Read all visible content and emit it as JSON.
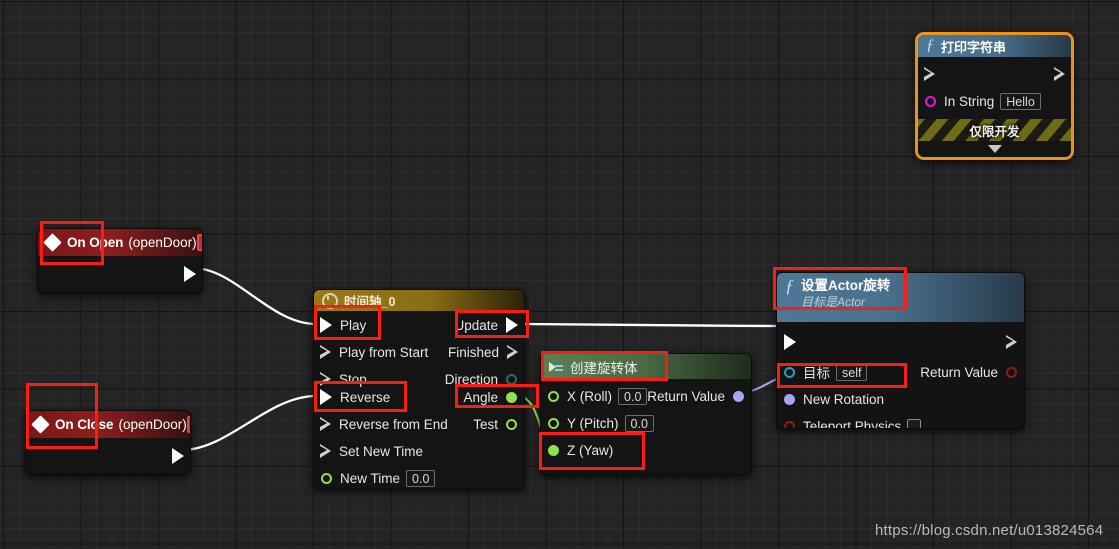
{
  "graph": {
    "watermark": "https://blog.csdn.net/u013824564",
    "accent_colors": {
      "annotation": "#fa1d16",
      "selected_node": "#e8941a",
      "exec_wire": "#ffffff",
      "float_wire": "#8fe24a",
      "rotator_wire": "#a3a8ee",
      "event_header": "#8d1e1e",
      "timeline_header": "#8a6d14",
      "function_header": "#49708d",
      "pure_header": "#4a6b44"
    }
  },
  "nodes": {
    "on_open": {
      "title": "On Open",
      "subtitle": "(openDoor)",
      "icon": "event-diamond-icon",
      "delegate_pin": "delegate-output-pin"
    },
    "on_close": {
      "title": "On Close",
      "subtitle": "(openDoor)",
      "icon": "event-diamond-icon",
      "delegate_pin": "delegate-output-pin"
    },
    "timeline": {
      "title": "时间轴_0",
      "icon": "clock-icon",
      "inputs": [
        {
          "label": "Play",
          "pin": "exec",
          "connected": true
        },
        {
          "label": "Play from Start",
          "pin": "exec",
          "connected": false
        },
        {
          "label": "Stop",
          "pin": "exec",
          "connected": false
        },
        {
          "label": "Reverse",
          "pin": "exec",
          "connected": true
        },
        {
          "label": "Reverse from End",
          "pin": "exec",
          "connected": false
        },
        {
          "label": "Set New Time",
          "pin": "exec",
          "connected": false
        },
        {
          "label": "New Time",
          "pin": "float",
          "connected": false,
          "value": "0.0"
        }
      ],
      "outputs": [
        {
          "label": "Update",
          "pin": "exec",
          "connected": true
        },
        {
          "label": "Finished",
          "pin": "exec",
          "connected": false
        },
        {
          "label": "Direction",
          "pin": "byte",
          "connected": false
        },
        {
          "label": "Angle",
          "pin": "float",
          "connected": true
        },
        {
          "label": "Test",
          "pin": "float",
          "connected": false
        }
      ]
    },
    "make_rotator": {
      "title": "创建旋转体",
      "icon": "pure-function-icon",
      "inputs": [
        {
          "label": "X (Roll)",
          "pin": "float",
          "connected": false,
          "value": "0.0"
        },
        {
          "label": "Y (Pitch)",
          "pin": "float",
          "connected": false,
          "value": "0.0"
        },
        {
          "label": "Z (Yaw)",
          "pin": "float",
          "connected": true
        }
      ],
      "outputs": [
        {
          "label": "Return Value",
          "pin": "rotator",
          "connected": true
        }
      ]
    },
    "set_actor_rotation": {
      "title": "设置Actor旋转",
      "subtitle": "目标是Actor",
      "icon": "function-fx-icon",
      "inputs": [
        {
          "label": "目标",
          "pin": "object",
          "connected": false,
          "value": "self"
        },
        {
          "label": "New Rotation",
          "pin": "rotator",
          "connected": true
        },
        {
          "label": "Teleport Physics",
          "pin": "bool",
          "connected": false,
          "value": false
        }
      ],
      "outputs": [
        {
          "label": "Return Value",
          "pin": "bool",
          "connected": false
        }
      ]
    },
    "print_string": {
      "title": "打印字符串",
      "icon": "function-fx-icon",
      "selected": true,
      "inputs": [
        {
          "label": "In String",
          "pin": "string",
          "connected": false,
          "value": "Hello"
        }
      ],
      "dev_only_label": "仅限开发",
      "collapse_icon": "chevron-down-icon"
    }
  },
  "annotations": [
    {
      "name": "annotation-on-open"
    },
    {
      "name": "annotation-on-close"
    },
    {
      "name": "annotation-play"
    },
    {
      "name": "annotation-reverse"
    },
    {
      "name": "annotation-update"
    },
    {
      "name": "annotation-angle"
    },
    {
      "name": "annotation-make-rotator-title"
    },
    {
      "name": "annotation-z-yaw"
    },
    {
      "name": "annotation-set-actor-rotation-title"
    },
    {
      "name": "annotation-new-rotation"
    }
  ]
}
